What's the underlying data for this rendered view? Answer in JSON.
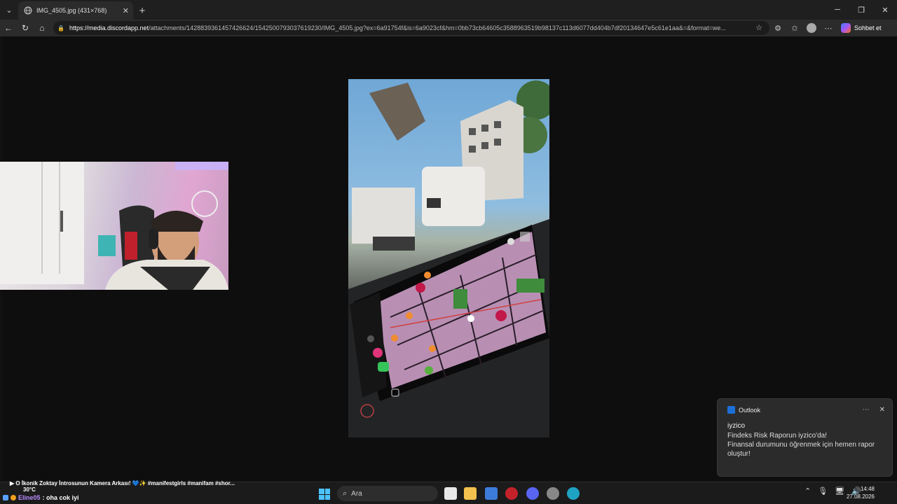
{
  "browser": {
    "tab": {
      "title": "IMG_4505.jpg (431×768)"
    },
    "address": {
      "url_host": "https://media.discordapp.net",
      "url_rest": "/attachments/1428839361457426624/1542500793037619230/IMG_4505.jpg?ex=6a91754f&is=6a9023cf&hm=0bb73cb64605c3588963519b98137c113d6077dd404b7df20134647e5c61e1aa&=&format=we..."
    },
    "copilot_label": "Sohbet et"
  },
  "notification": {
    "app": "Outlook",
    "sender": "iyzico",
    "line1": "Findeks Risk Raporun iyzico'da!",
    "line2": "Finansal durumunu öğrenmek için hemen rapor oluştur!"
  },
  "overlay": {
    "now_playing": "▶ O İkonik Zoktay İntrosunun Kamera Arkası! 💙✨ #manifestgirls #manifam #shor...",
    "chat_user": "Eline05",
    "chat_message": ": oha cok iyi",
    "weather_temp": "30°C"
  },
  "taskbar": {
    "search_placeholder": "Ara",
    "time": "14:48",
    "date": "27.08.2026"
  }
}
